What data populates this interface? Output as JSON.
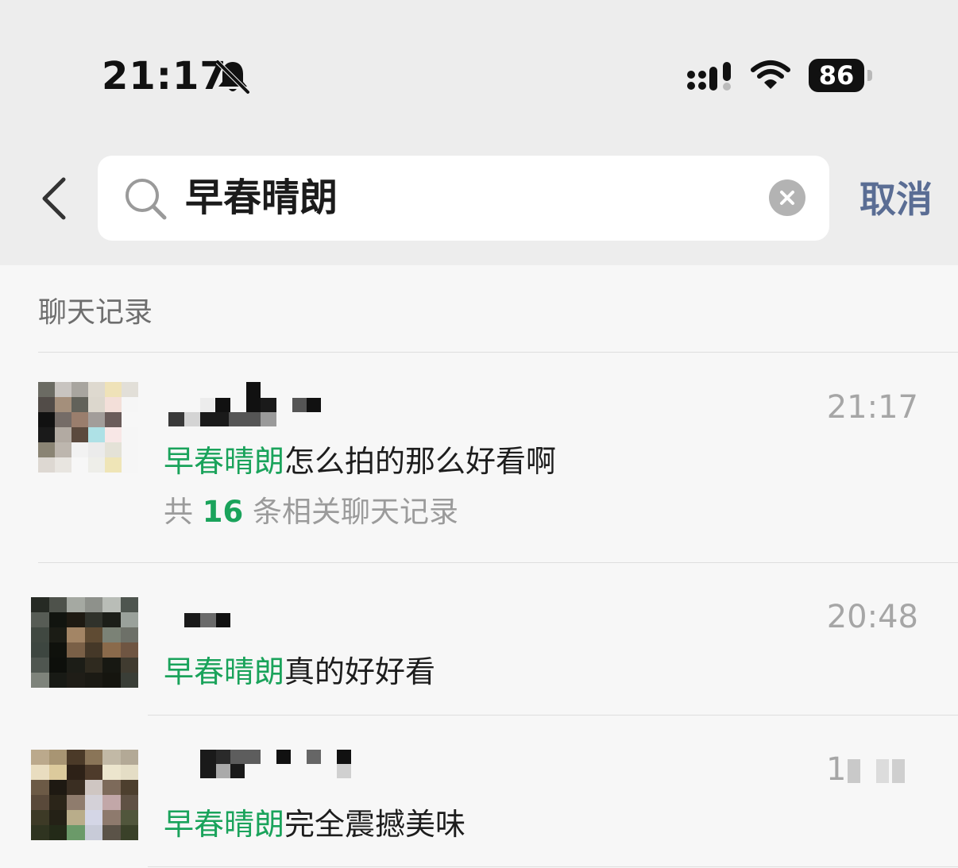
{
  "status_bar": {
    "time": "21:17",
    "battery": "86"
  },
  "search": {
    "query": "早春晴朗",
    "cancel_label": "取消"
  },
  "section_title": "聊天记录",
  "results": [
    {
      "highlight": "早春晴朗",
      "rest": "怎么拍的那么好看啊",
      "time": "21:17",
      "summary_prefix": "共",
      "summary_count": "16",
      "summary_suffix": "条相关聊天记录"
    },
    {
      "highlight": "早春晴朗",
      "rest": "真的好好看",
      "time": "20:48"
    },
    {
      "highlight": "早春晴朗",
      "rest": "完全震撼美味",
      "time": "1"
    }
  ],
  "colors": {
    "highlight": "#1aa35b",
    "cancel": "#5a6d94"
  }
}
